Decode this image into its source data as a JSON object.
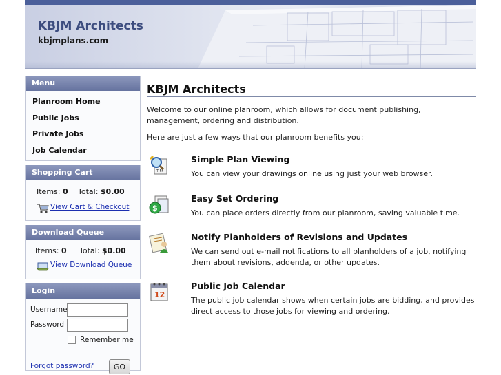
{
  "header": {
    "title": "KBJM Architects",
    "url": "kbjmplans.com"
  },
  "menu": {
    "heading": "Menu",
    "items": [
      {
        "label": "Planroom Home"
      },
      {
        "label": "Public Jobs"
      },
      {
        "label": "Private Jobs"
      },
      {
        "label": "Job Calendar"
      }
    ]
  },
  "cart": {
    "heading": "Shopping Cart",
    "items_label": "Items:",
    "items_value": "0",
    "total_label": "Total:",
    "total_value": "$0.00",
    "link": "View Cart & Checkout"
  },
  "download": {
    "heading": "Download Queue",
    "items_label": "Items:",
    "items_value": "0",
    "total_label": "Total:",
    "total_value": "$0.00",
    "link": "View Download Queue"
  },
  "login": {
    "heading": "Login",
    "username_label": "Username",
    "password_label": "Password",
    "remember_label": "Remember me",
    "forgot_link": "Forgot password?",
    "go_label": "GO"
  },
  "main": {
    "title": "KBJM Architects",
    "intro": "Welcome to our online planroom, which allows for document publishing, management, ordering and distribution.",
    "intro2": "Here are just a few ways that our planroom benefits you:",
    "features": [
      {
        "title": "Simple Plan Viewing",
        "text": "You can view your drawings online using just your web browser.",
        "icon": "magnifier-document-icon"
      },
      {
        "title": "Easy Set Ordering",
        "text": "You can place orders directly from our planroom, saving valuable time.",
        "icon": "dollar-order-icon"
      },
      {
        "title": "Notify Planholders of Revisions and Updates",
        "text": "We can send out e-mail notifications to all planholders of a job, notifying them about revisions, addenda, or other updates.",
        "icon": "notify-user-icon"
      },
      {
        "title": "Public Job Calendar",
        "text": "The public job calendar shows when certain jobs are bidding, and provides direct access to those jobs for viewing and ordering.",
        "icon": "calendar-icon"
      }
    ]
  },
  "colors": {
    "accent": "#4b5f9a",
    "title_blue": "#3d4d7f",
    "link": "#1c2fb0"
  }
}
